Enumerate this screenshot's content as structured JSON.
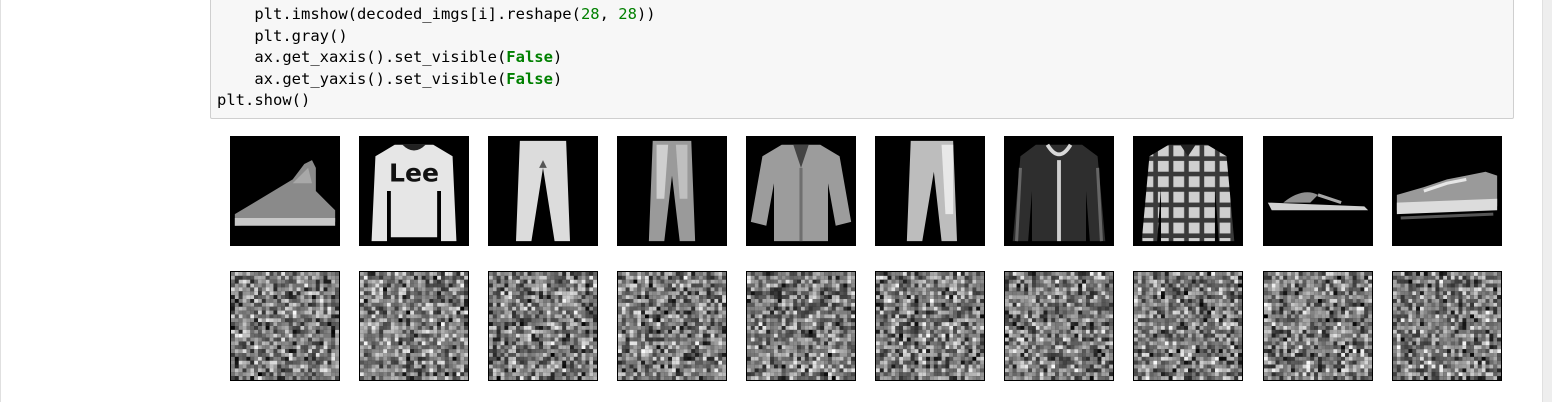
{
  "code_cell": {
    "lines": [
      [
        {
          "t": "    plt.imshow(decoded_imgs[i].reshape("
        },
        {
          "t": "28",
          "c": "num"
        },
        {
          "t": ", "
        },
        {
          "t": "28",
          "c": "num"
        },
        {
          "t": "))"
        }
      ],
      [
        {
          "t": "    plt.gray()"
        }
      ],
      [
        {
          "t": "    ax.get_xaxis().set_visible("
        },
        {
          "t": "False",
          "c": "kw-false"
        },
        {
          "t": ")"
        }
      ],
      [
        {
          "t": "    ax.get_yaxis().set_visible("
        },
        {
          "t": "False",
          "c": "kw-false"
        },
        {
          "t": ")"
        }
      ],
      [
        {
          "t": "plt.show()"
        }
      ]
    ]
  },
  "output": {
    "originals": [
      "ankle-boot",
      "sweater",
      "trouser",
      "trouser",
      "shirt",
      "trouser",
      "coat",
      "shirt",
      "sandal",
      "sneaker"
    ],
    "reconstructions_count": 10,
    "noise_colormap": "gray"
  }
}
